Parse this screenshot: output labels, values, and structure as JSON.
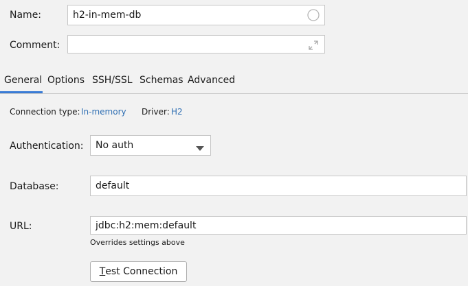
{
  "form": {
    "name_label": "Name:",
    "name_value": "h2-in-mem-db",
    "comment_label": "Comment:",
    "comment_value": ""
  },
  "tabs": [
    {
      "label": "General",
      "active": true
    },
    {
      "label": "Options"
    },
    {
      "label": "SSH/SSL"
    },
    {
      "label": "Schemas"
    },
    {
      "label": "Advanced"
    }
  ],
  "general": {
    "connection_type_label": "Connection type:",
    "connection_type_value": "In-memory",
    "driver_label": "Driver:",
    "driver_value": "H2",
    "authentication_label": "Authentication:",
    "authentication_value": "No auth",
    "database_label": "Database:",
    "database_value": "default",
    "url_label": "URL:",
    "url_value": "jdbc:h2:mem:default",
    "url_hint": "Overrides settings above",
    "test_button_mnemonic": "T",
    "test_button_rest": "est Connection"
  },
  "colors": {
    "link": "#2f6fb3",
    "background": "#f2f2f2"
  },
  "icons": {
    "name_field": "circle-icon",
    "comment_field": "expand-icon",
    "auth_dropdown": "dropdown-arrow-icon"
  }
}
